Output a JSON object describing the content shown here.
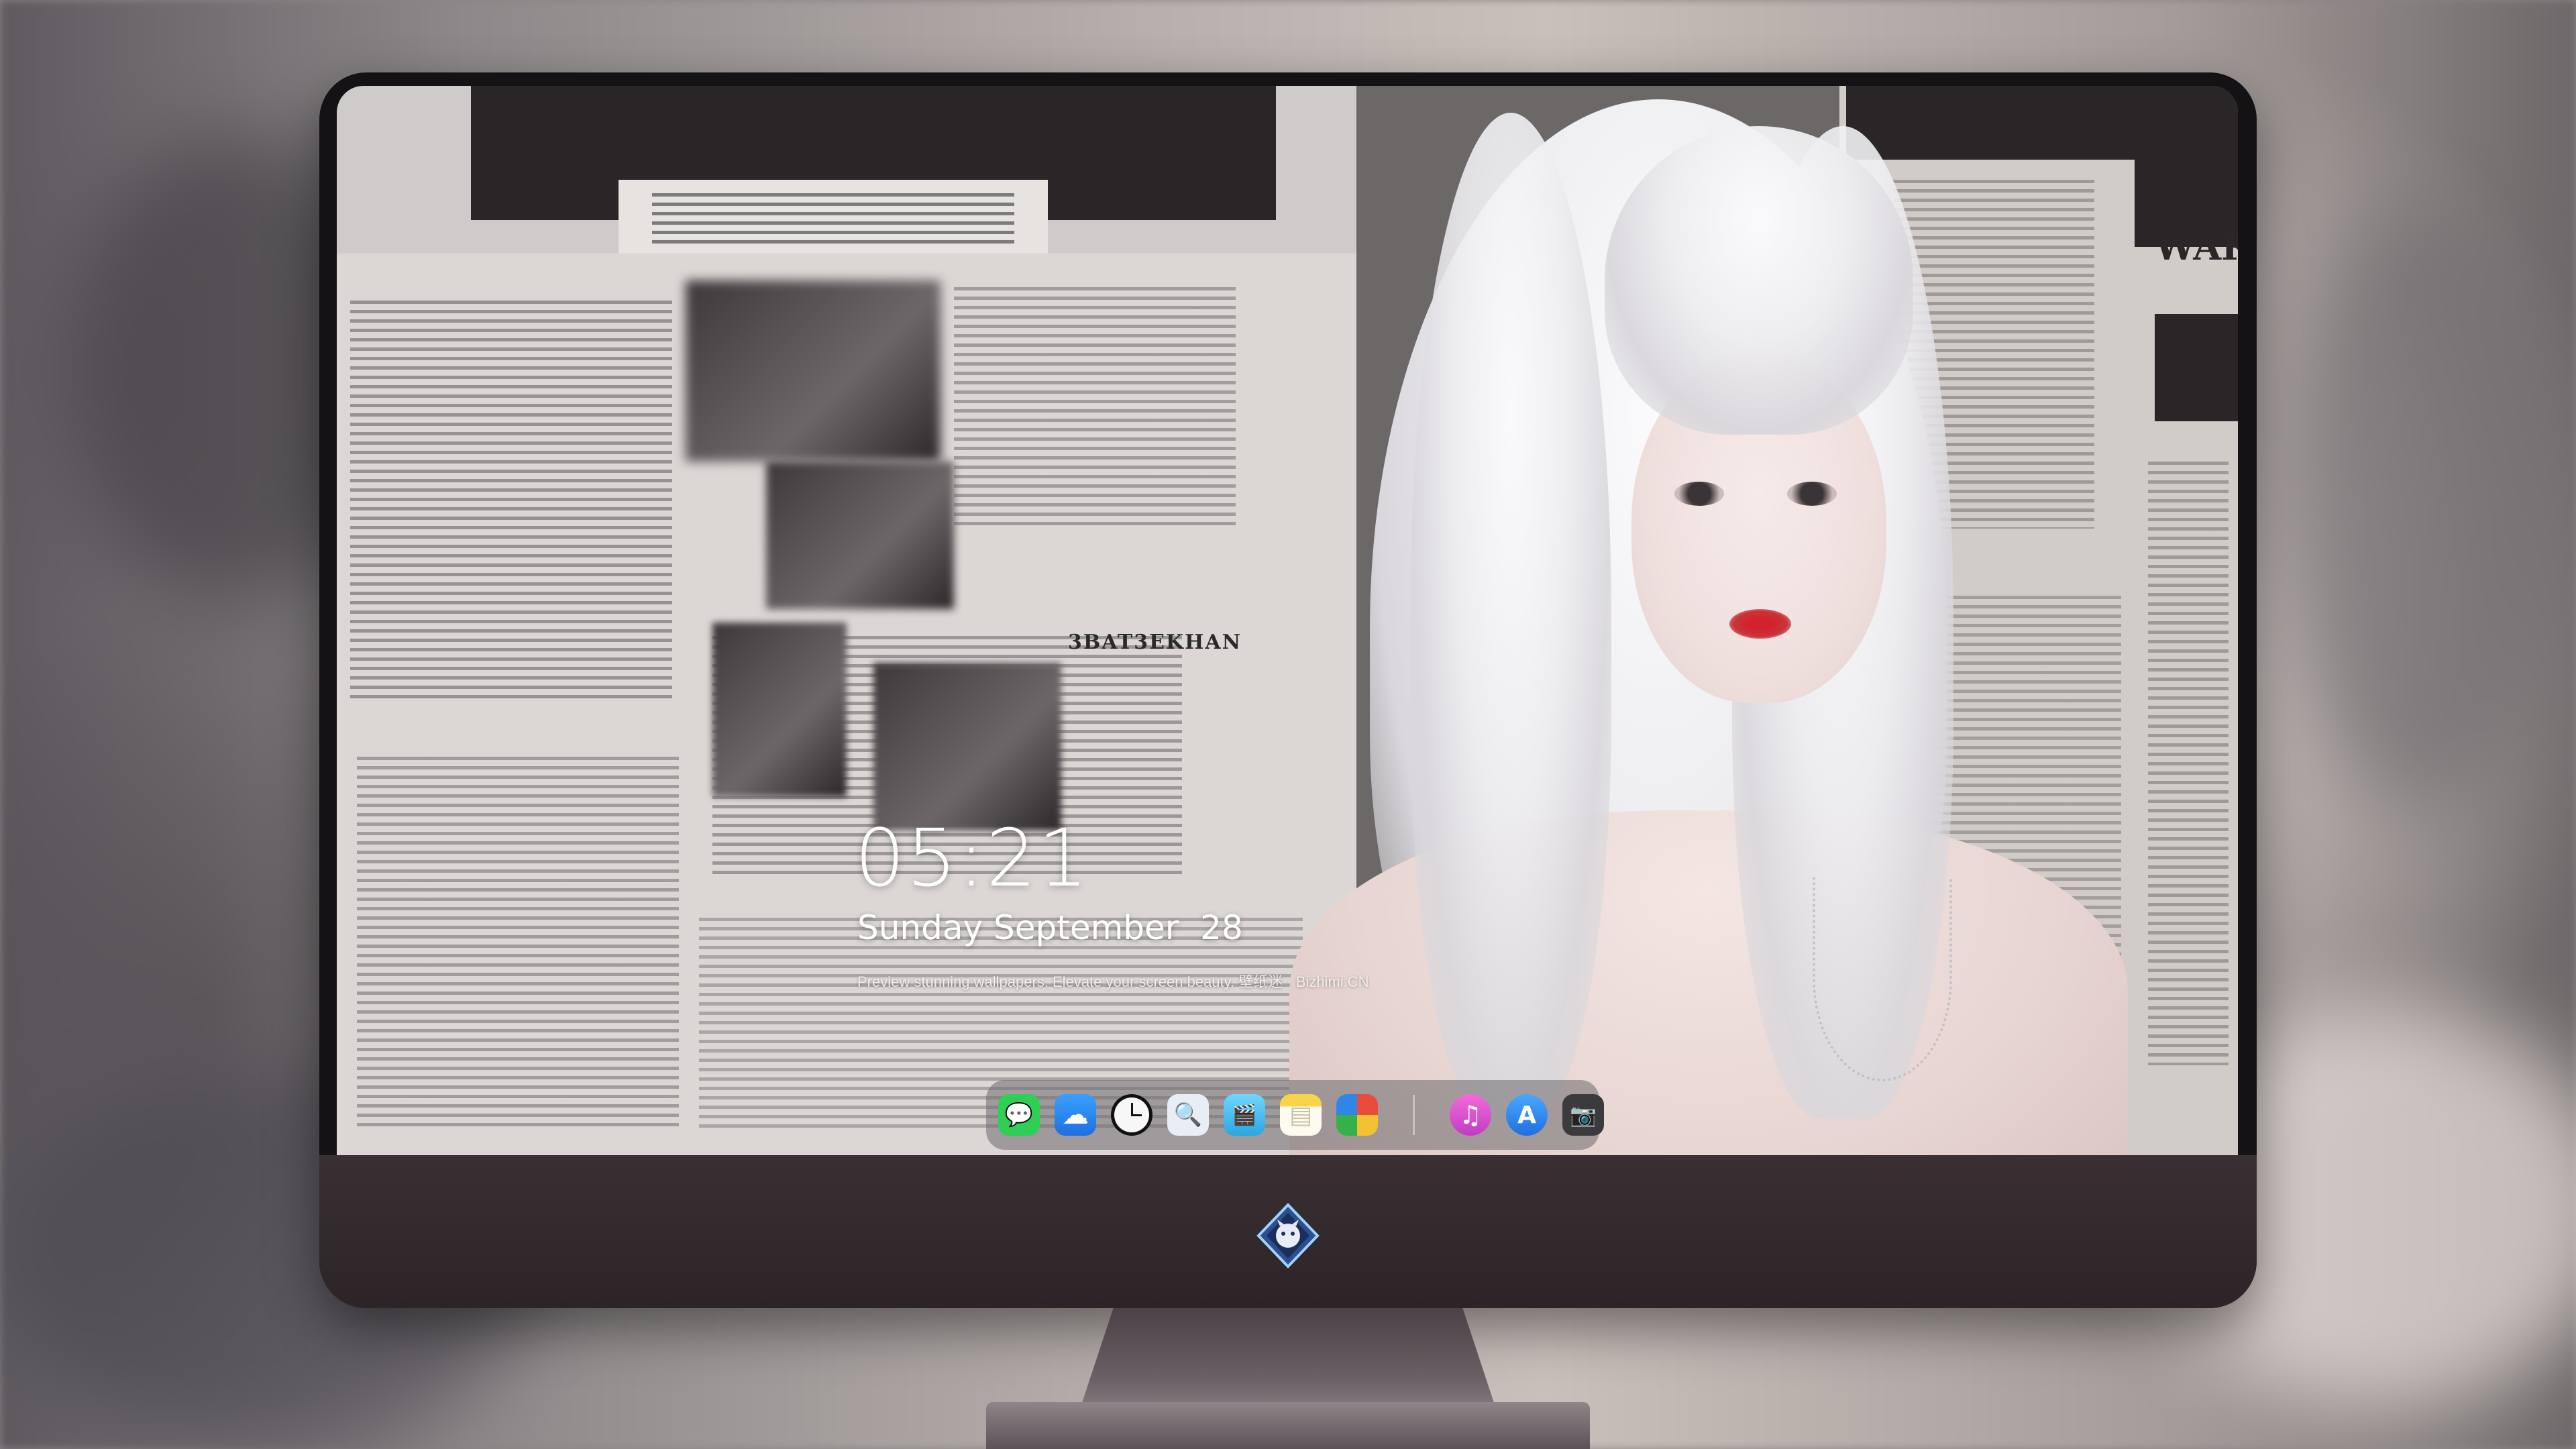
{
  "lockscreen": {
    "time": "05:21",
    "date": "Sunday September  28",
    "tagline": "Preview stunning wallpapers. Elevate your screen beauty. 壁纸迷 · Bizhimi.CN"
  },
  "dock": {
    "apps": [
      {
        "name": "messages-icon",
        "color": "#2fcf55",
        "glyph": "💬"
      },
      {
        "name": "weather-icon",
        "color": "#2a8cf0",
        "glyph": "☁"
      },
      {
        "name": "clock-icon",
        "color": "#f5f5f5",
        "glyph": "🕐"
      },
      {
        "name": "preview-icon",
        "color": "#e9eef6",
        "glyph": "🔍"
      },
      {
        "name": "clips-icon",
        "color": "#38b6e8",
        "glyph": "🎬"
      },
      {
        "name": "notes-icon",
        "color": "#f7d44a",
        "glyph": "▤"
      },
      {
        "name": "photo-booth-icon",
        "color": "#e8e8e8",
        "glyph": "▦"
      },
      {
        "name": "music-icon",
        "color": "#e44bd0",
        "glyph": "♫"
      },
      {
        "name": "app-store-icon",
        "color": "#2b8cf3",
        "glyph": "A"
      },
      {
        "name": "screenshot-icon",
        "color": "#3b3b3d",
        "glyph": "📷"
      }
    ]
  },
  "wallpaper": {
    "newspaper_headline_1": "WAR",
    "newspaper_headline_2": "3BAT3EKHAN"
  }
}
